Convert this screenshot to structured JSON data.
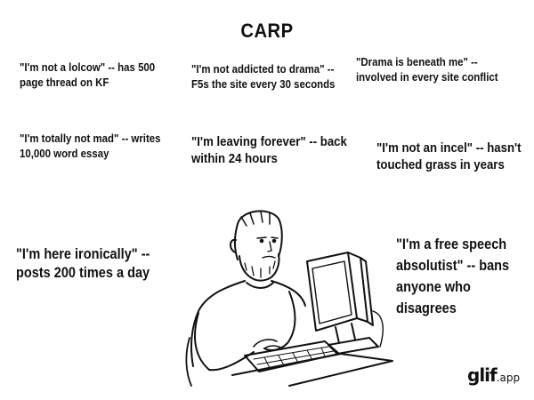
{
  "title": "CARP",
  "captions": [
    "\"I'm not a lolcow\" -- has 500 page thread on KF",
    "\"I'm not addicted to drama\" -- F5s the site every 30 seconds",
    "\"Drama is beneath me\" -- involved in every site conflict",
    "\"I'm totally not mad\" -- writes 10,000 word essay",
    "\"I'm leaving forever\" -- back within 24 hours",
    "\"I'm not an incel\" -- hasn't touched grass in years",
    "\"I'm here ironically\" -- posts 200 times a day",
    "\"I'm a free speech absolutist\" -- bans anyone who disagrees"
  ],
  "watermark": {
    "main": "glif",
    "suffix": ".app"
  }
}
